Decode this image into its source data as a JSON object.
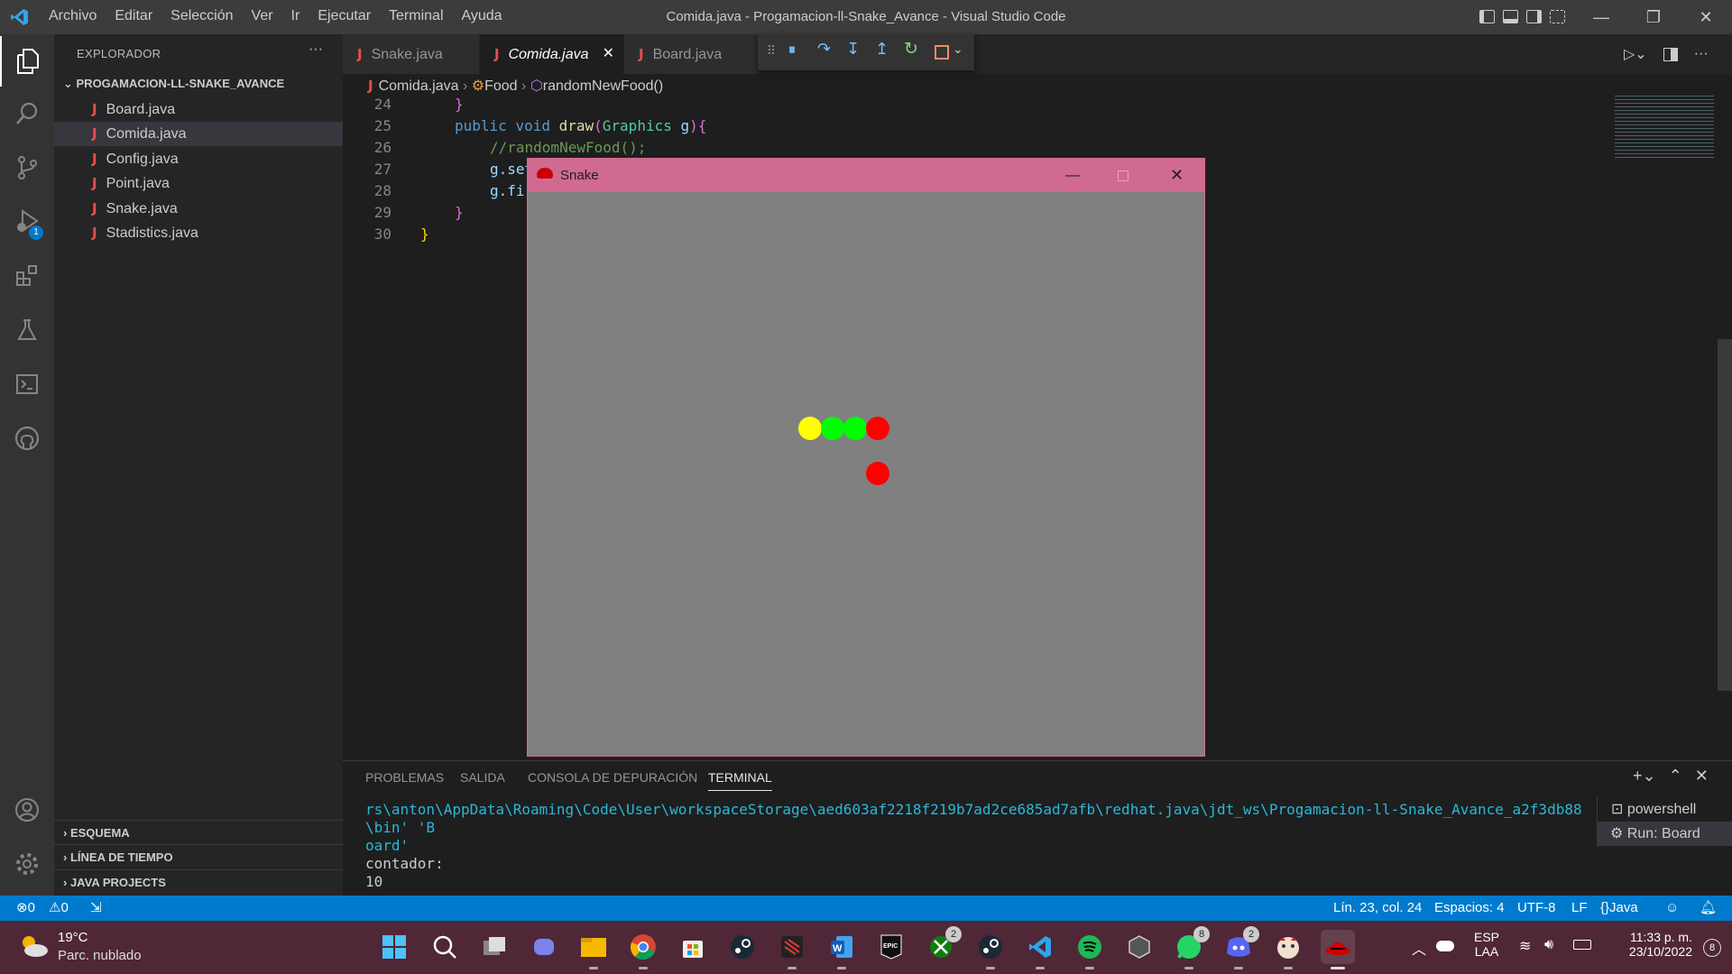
{
  "window": {
    "title": "Comida.java - Progamacion-ll-Snake_Avance - Visual Studio Code",
    "menu": [
      "Archivo",
      "Editar",
      "Selección",
      "Ver",
      "Ir",
      "Ejecutar",
      "Terminal",
      "Ayuda"
    ]
  },
  "activity": {
    "debug_badge": "1"
  },
  "explorer": {
    "title": "EXPLORADOR",
    "more": "···",
    "project": "PROGAMACION-LL-SNAKE_AVANCE",
    "files": [
      "Board.java",
      "Comida.java",
      "Config.java",
      "Point.java",
      "Snake.java",
      "Stadistics.java"
    ],
    "selected_index": 1,
    "sections": [
      "ESQUEMA",
      "LÍNEA DE TIEMPO",
      "JAVA PROJECTS"
    ]
  },
  "editor": {
    "tabs": [
      "Snake.java",
      "Comida.java",
      "Board.java"
    ],
    "active_tab": "Comida.java",
    "breadcrumb": {
      "file": "Comida.java",
      "class": "Food",
      "method": "randomNewFood()"
    },
    "line_numbers": [
      "24",
      "25",
      "26",
      "27",
      "28",
      "29",
      "30"
    ],
    "code": {
      "l24": "}",
      "l25_kw1": "public",
      "l25_kw2": "void",
      "l25_fn": "draw",
      "l25_type": "Graphics",
      "l25_param": "g",
      "l26": "//randomNewFood();",
      "l27": "g.set",
      "l28": "g.fi",
      "l29": "}",
      "l30": "}"
    }
  },
  "snake_window": {
    "title": "Snake",
    "body_color": "#808080",
    "titlebar_color": "#d06a91",
    "snake_colors": [
      "#ffff00",
      "#00ff00",
      "#00ff00",
      "#ff0000"
    ],
    "food_color": "#ff0000"
  },
  "panel": {
    "tabs": [
      "PROBLEMAS",
      "SALIDA",
      "CONSOLA DE DEPURACIÓN",
      "TERMINAL"
    ],
    "active_tab": "TERMINAL",
    "terminal_lines": [
      "rs\\anton\\AppData\\Roaming\\Code\\User\\workspaceStorage\\aed603af2218f219b7ad2ce685ad7afb\\redhat.java\\jdt_ws\\Progamacion-ll-Snake_Avance_a2f3db88\\bin' 'B",
      "oard'",
      "contador:",
      "10"
    ],
    "terminals": [
      "powershell",
      "Run: Board"
    ]
  },
  "status": {
    "errors": "0",
    "warnings": "0",
    "position": "Lín. 23, col. 24",
    "spaces": "Espacios: 4",
    "encoding": "UTF-8",
    "eol": "LF",
    "language": "Java"
  },
  "taskbar": {
    "weather_temp": "19°C",
    "weather_desc": "Parc. nublado",
    "lang": "ESP",
    "layout": "LAA",
    "time": "11:33 p. m.",
    "date": "23/10/2022",
    "notifications": "8",
    "xbox_badge": "2",
    "whatsapp_badge": "8",
    "discord_badge": "2",
    "icons": [
      "windows-start",
      "search",
      "task-view",
      "teams",
      "file-explorer",
      "chrome",
      "ms-store",
      "steam",
      "devapp",
      "word",
      "epic-games",
      "xbox",
      "steam-2",
      "vscode",
      "spotify",
      "unity",
      "whatsapp",
      "discord",
      "game",
      "redhat"
    ]
  },
  "colors": {
    "accent": "#007acc",
    "java_icon": "#f14c4c",
    "taskbar": "#4f2736"
  }
}
